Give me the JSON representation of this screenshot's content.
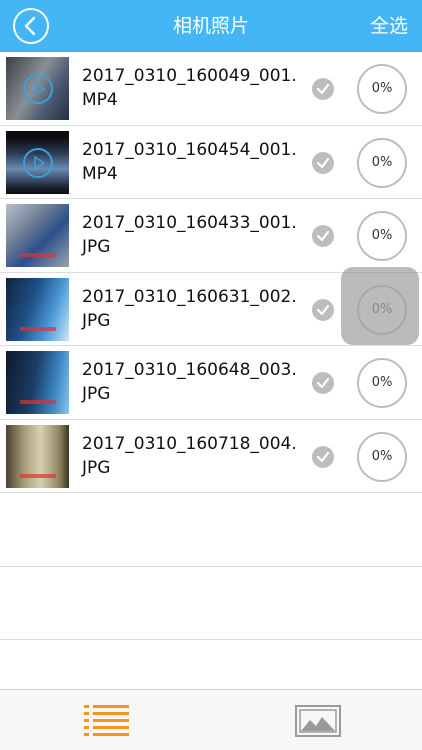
{
  "header": {
    "title": "相机照片",
    "select_all_label": "全选"
  },
  "files": [
    {
      "name": "2017_0310_160049_001.MP4",
      "type": "video",
      "progress": "0%",
      "selected": true,
      "thumb_bg": "#5a6068"
    },
    {
      "name": "2017_0310_160454_001.MP4",
      "type": "video",
      "progress": "0%",
      "selected": true,
      "thumb_bg": "#3a4a5e"
    },
    {
      "name": "2017_0310_160433_001.JPG",
      "type": "photo",
      "progress": "0%",
      "selected": true,
      "thumb_bg": "#6f7f95"
    },
    {
      "name": "2017_0310_160631_002.JPG",
      "type": "photo",
      "progress": "0%",
      "selected": true,
      "thumb_bg": "#2f6aa0",
      "pressed": true
    },
    {
      "name": "2017_0310_160648_003.JPG",
      "type": "photo",
      "progress": "0%",
      "selected": true,
      "thumb_bg": "#24466e"
    },
    {
      "name": "2017_0310_160718_004.JPG",
      "type": "photo",
      "progress": "0%",
      "selected": true,
      "thumb_bg": "#8a7f60"
    }
  ],
  "tabs": {
    "list_icon": "list-icon",
    "gallery_icon": "image-icon"
  },
  "colors": {
    "nav_bg": "#44b6f6",
    "tab_active": "#f7941d",
    "tab_inactive": "#9a9a9a",
    "check": "#bdbdbd"
  }
}
